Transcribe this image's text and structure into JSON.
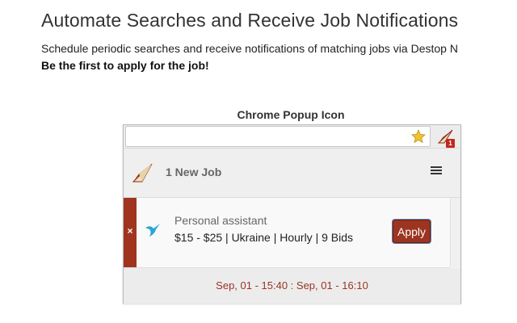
{
  "page": {
    "title": "Automate Searches and Receive Job Notifications",
    "description": "Schedule periodic searches and receive notifications of matching jobs via Destop N",
    "tagline": "Be the first to apply for the job!"
  },
  "popup": {
    "caption": "Chrome Popup Icon",
    "extension_badge": "1",
    "header": {
      "job_count": "1 New Job"
    },
    "job": {
      "dismiss_label": "×",
      "title": "Personal assistant",
      "details": "$15 - $25 | Ukraine | Hourly | 9 Bids",
      "apply_label": "Apply"
    },
    "footer": {
      "time_range": "Sep, 01 - 15:40 : Sep, 01 - 16:10"
    }
  },
  "icons": {
    "star": "star-icon",
    "extension": "extension-icon",
    "logo": "logo-icon",
    "menu": "menu-icon",
    "bird": "bird-icon"
  },
  "colors": {
    "accent": "#9b3420",
    "badge": "#c0281d",
    "bird": "#2aa6d6",
    "star": "#f3c22c"
  }
}
